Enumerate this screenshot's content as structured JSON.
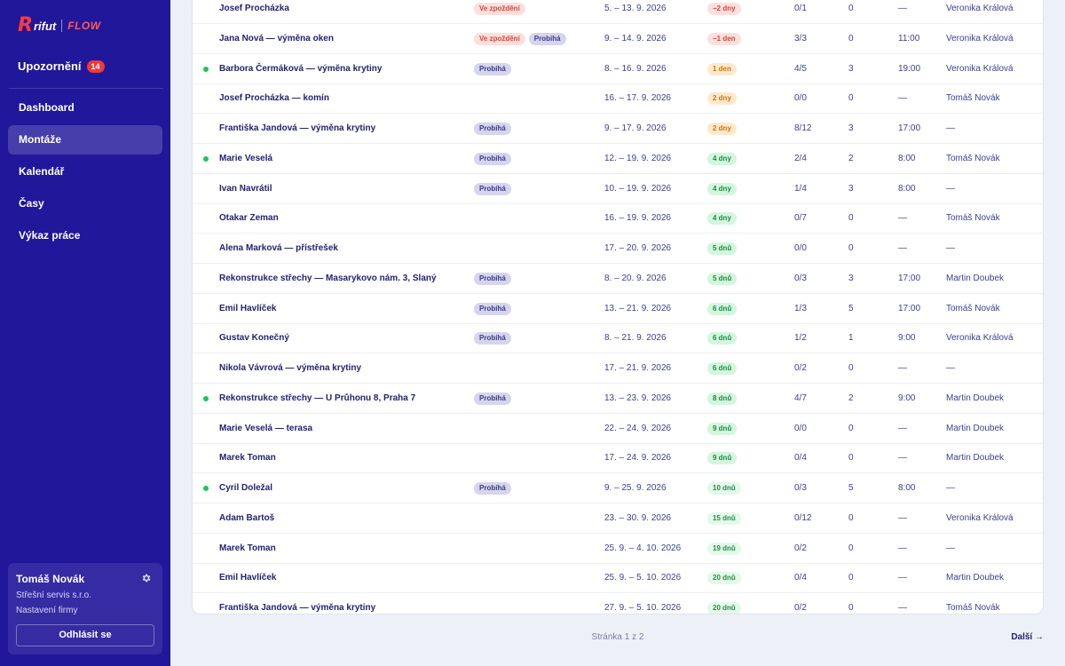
{
  "app": {
    "logo_r": "R",
    "logo_rifut": "rifut",
    "logo_flow": "FLOW"
  },
  "sidebar": {
    "notifications_label": "Upozornění",
    "notifications_count": "14",
    "nav": [
      "Dashboard",
      "Montáže",
      "Kalendář",
      "Časy",
      "Výkaz práce"
    ],
    "active": "Montáže",
    "user": {
      "name": "Tomáš Novák",
      "company": "Střešní servis s.r.o.",
      "settings": "Nastavení firmy",
      "logout": "Odhlásit se"
    }
  },
  "colors": {
    "sidebar": "#21179a",
    "late": "#d8453b",
    "running": "#3b3a86",
    "active_dot": "#1ec25f"
  },
  "rows": [
    {
      "dot": false,
      "name": "Josef Procházka",
      "statuses": [
        "Ve zpoždění"
      ],
      "dates": "5. – 13. 9. 2026",
      "left": "−2 dny",
      "left_tone": "red",
      "tasks": "0/1",
      "num": "0",
      "time": "—",
      "resp": "Veronika Králová"
    },
    {
      "dot": false,
      "name": "Jana Nová — výměna oken",
      "statuses": [
        "Ve zpoždění",
        "Probíhá"
      ],
      "dates": "9. – 14. 9. 2026",
      "left": "−1 den",
      "left_tone": "red",
      "tasks": "3/3",
      "num": "0",
      "time": "11:00",
      "resp": "Veronika Králová"
    },
    {
      "dot": true,
      "name": "Barbora Čermáková — výměna krytiny",
      "statuses": [
        "Probíhá"
      ],
      "dates": "8. – 16. 9. 2026",
      "left": "1 den",
      "left_tone": "orange",
      "tasks": "4/5",
      "num": "3",
      "time": "19:00",
      "resp": "Veronika Králová"
    },
    {
      "dot": false,
      "name": "Josef Procházka — komín",
      "statuses": [],
      "dates": "16. – 17. 9. 2026",
      "left": "2 dny",
      "left_tone": "orange",
      "tasks": "0/0",
      "num": "0",
      "time": "—",
      "resp": "Tomáš Novák"
    },
    {
      "dot": false,
      "name": "Františka Jandová — výměna krytiny",
      "statuses": [
        "Probíhá"
      ],
      "dates": "9. – 17. 9. 2026",
      "left": "2 dny",
      "left_tone": "orange",
      "tasks": "8/12",
      "num": "3",
      "time": "17:00",
      "resp": "—"
    },
    {
      "dot": true,
      "name": "Marie Veselá",
      "statuses": [
        "Probíhá"
      ],
      "dates": "12. – 19. 9. 2026",
      "left": "4 dny",
      "left_tone": "green",
      "tasks": "2/4",
      "num": "2",
      "time": "8:00",
      "resp": "Tomáš Novák"
    },
    {
      "dot": false,
      "name": "Ivan Navrátil",
      "statuses": [
        "Probíhá"
      ],
      "dates": "10. – 19. 9. 2026",
      "left": "4 dny",
      "left_tone": "green",
      "tasks": "1/4",
      "num": "3",
      "time": "8:00",
      "resp": "—"
    },
    {
      "dot": false,
      "name": "Otakar Zeman",
      "statuses": [],
      "dates": "16. – 19. 9. 2026",
      "left": "4 dny",
      "left_tone": "green",
      "tasks": "0/7",
      "num": "0",
      "time": "—",
      "resp": "Tomáš Novák"
    },
    {
      "dot": false,
      "name": "Alena Marková — přístřešek",
      "statuses": [],
      "dates": "17. – 20. 9. 2026",
      "left": "5 dnů",
      "left_tone": "green",
      "tasks": "0/0",
      "num": "0",
      "time": "—",
      "resp": "—"
    },
    {
      "dot": false,
      "name": "Rekonstrukce střechy — Masarykovo nám. 3, Slaný",
      "statuses": [
        "Probíhá"
      ],
      "dates": "8. – 20. 9. 2026",
      "left": "5 dnů",
      "left_tone": "green",
      "tasks": "0/3",
      "num": "3",
      "time": "17:00",
      "resp": "Martin Doubek"
    },
    {
      "dot": false,
      "name": "Emil Havlíček",
      "statuses": [
        "Probíhá"
      ],
      "dates": "13. – 21. 9. 2026",
      "left": "6 dnů",
      "left_tone": "green",
      "tasks": "1/3",
      "num": "5",
      "time": "17:00",
      "resp": "Tomáš Novák"
    },
    {
      "dot": false,
      "name": "Gustav Konečný",
      "statuses": [
        "Probíhá"
      ],
      "dates": "8. – 21. 9. 2026",
      "left": "6 dnů",
      "left_tone": "green",
      "tasks": "1/2",
      "num": "1",
      "time": "9:00",
      "resp": "Veronika Králová"
    },
    {
      "dot": false,
      "name": "Nikola Vávrová — výměna krytiny",
      "statuses": [],
      "dates": "17. – 21. 9. 2026",
      "left": "6 dnů",
      "left_tone": "green",
      "tasks": "0/2",
      "num": "0",
      "time": "—",
      "resp": "—"
    },
    {
      "dot": true,
      "name": "Rekonstrukce střechy — U Průhonu 8, Praha 7",
      "statuses": [
        "Probíhá"
      ],
      "dates": "13. – 23. 9. 2026",
      "left": "8 dnů",
      "left_tone": "green",
      "tasks": "4/7",
      "num": "2",
      "time": "9:00",
      "resp": "Martin Doubek"
    },
    {
      "dot": false,
      "name": "Marie Veselá — terasa",
      "statuses": [],
      "dates": "22. – 24. 9. 2026",
      "left": "9 dnů",
      "left_tone": "green",
      "tasks": "0/0",
      "num": "0",
      "time": "—",
      "resp": "Martin Doubek"
    },
    {
      "dot": false,
      "name": "Marek Toman",
      "statuses": [],
      "dates": "17. – 24. 9. 2026",
      "left": "9 dnů",
      "left_tone": "green",
      "tasks": "0/4",
      "num": "0",
      "time": "—",
      "resp": "Martin Doubek"
    },
    {
      "dot": true,
      "name": "Cyril Doležal",
      "statuses": [
        "Probíhá"
      ],
      "dates": "9. – 25. 9. 2026",
      "left": "10 dnů",
      "left_tone": "lgreen",
      "tasks": "0/3",
      "num": "5",
      "time": "8:00",
      "resp": "—"
    },
    {
      "dot": false,
      "name": "Adam Bartoš",
      "statuses": [],
      "dates": "23. – 30. 9. 2026",
      "left": "15 dnů",
      "left_tone": "lgreen",
      "tasks": "0/12",
      "num": "0",
      "time": "—",
      "resp": "Veronika Králová"
    },
    {
      "dot": false,
      "name": "Marek Toman",
      "statuses": [],
      "dates": "25. 9. – 4. 10. 2026",
      "left": "19 dnů",
      "left_tone": "lgreen",
      "tasks": "0/2",
      "num": "0",
      "time": "—",
      "resp": "—"
    },
    {
      "dot": false,
      "name": "Emil Havlíček",
      "statuses": [],
      "dates": "25. 9. – 5. 10. 2026",
      "left": "20 dnů",
      "left_tone": "lgreen",
      "tasks": "0/4",
      "num": "0",
      "time": "—",
      "resp": "Martin Doubek"
    },
    {
      "dot": false,
      "name": "Františka Jandová — výměna krytiny",
      "statuses": [],
      "dates": "27. 9. – 5. 10. 2026",
      "left": "20 dnů",
      "left_tone": "lgreen",
      "tasks": "0/2",
      "num": "0",
      "time": "—",
      "resp": "Tomáš Novák"
    }
  ],
  "pager": {
    "text": "Stránka 1 z 2",
    "next": "Další →"
  }
}
